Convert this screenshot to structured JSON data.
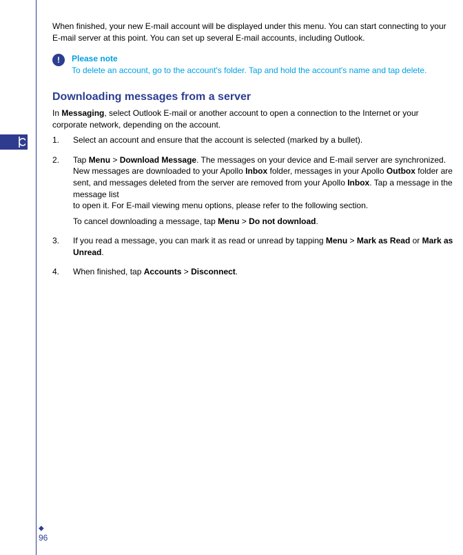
{
  "intro": "When finished, your new E-mail account will be displayed under this menu. You can start connecting to your E-mail server at this point. You can set up several E-mail accounts, including Outlook.",
  "note": {
    "icon_glyph": "!",
    "title": "Please note",
    "body": "To delete an account, go to the account's folder. Tap and hold the account's name and tap delete."
  },
  "heading": "Downloading messages from a server",
  "lead_pre": "In ",
  "lead_b1": "Messaging",
  "lead_post": ", select Outlook E-mail or another account to open a connection to the Internet or your corporate network, depending on the account.",
  "items": {
    "n1": "1.",
    "t1": "Select an account and ensure that the account is selected (marked by a bullet).",
    "n2": "2.",
    "t2_a": "Tap ",
    "t2_b1": "Menu",
    "t2_b2": "Download Message",
    "t2_c": ". The messages on your device and E-mail server are synchronized. New messages are downloaded to your Apollo ",
    "t2_b3": "Inbox",
    "t2_d": " folder, messages in your Apollo ",
    "t2_b4": "Outbox",
    "t2_e": " folder are sent, and messages deleted from the server are removed from your Apollo ",
    "t2_b5": "Inbox",
    "t2_f": ". Tap a message in the message list",
    "t2_g": "to open it. For E-mail viewing menu options, please refer to the following section.",
    "t2_cancel_a": "To cancel downloading a message, tap ",
    "t2_cancel_b1": "Menu",
    "t2_cancel_b2": "Do not download",
    "n3": "3.",
    "t3_a": "If you read a message, you can mark it as read or unread by tapping ",
    "t3_b1": "Menu",
    "t3_b2": "Mark as Read",
    "t3_mid": " or ",
    "t3_b3": "Mark as Unread",
    "n4": "4.",
    "t4_a": "When finished, tap ",
    "t4_b1": "Accounts",
    "t4_b2": "Disconnect"
  },
  "gt": " > ",
  "period": ".",
  "page_number": "96",
  "diamond": "◆"
}
